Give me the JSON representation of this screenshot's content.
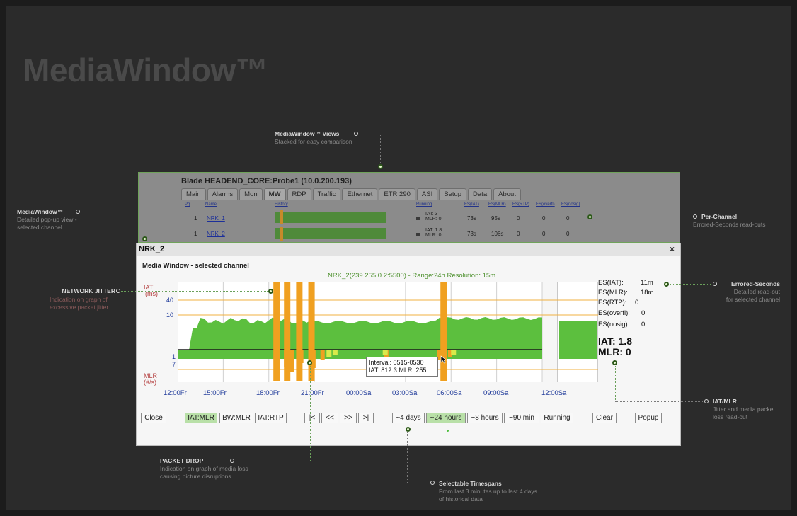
{
  "brand": "MediaWindow™",
  "annotations": {
    "views": {
      "title": "MediaWindow™ Views",
      "desc": "Stacked for easy comparison"
    },
    "popup": {
      "title": "MediaWindow™",
      "desc1": "Detailed pop-up view -",
      "desc2": "selected channel"
    },
    "per_channel": {
      "title": "Per-Channel",
      "desc": "Errored-Seconds read-outs"
    },
    "jitter": {
      "title": "NETWORK JITTER",
      "desc1": "Indication on graph of",
      "desc2": "excessive packet jitter"
    },
    "errored": {
      "title": "Errored-Seconds",
      "desc1": "Detailed read-out",
      "desc2": "for selected channel"
    },
    "iat_mlr": {
      "title": "IAT/MLR",
      "desc1": "Jitter and media packet",
      "desc2": "loss read-out"
    },
    "packet_drop": {
      "title": "PACKET DROP",
      "desc1": "Indication on graph of media loss",
      "desc2": "causing picture disruptions"
    },
    "timespans": {
      "title": "Selectable Timespans",
      "desc1": "From last 3 minutes up to last 4 days",
      "desc2": "of historical data"
    }
  },
  "blade": {
    "title": "Blade HEADEND_CORE:Probe1 (10.0.200.193)",
    "tabs": [
      "Main",
      "Alarms",
      "Mon",
      "MW",
      "RDP",
      "Traffic",
      "Ethernet",
      "ETR 290",
      "ASI",
      "Setup",
      "Data",
      "About"
    ],
    "active_tab": "MW",
    "headers": {
      "pg": "Pg",
      "name": "Name",
      "history": "History",
      "running": "Running",
      "es_iat": "ES(IAT)",
      "es_mlr": "ES(MLR)",
      "es_rtp": "ES(RTP)",
      "es_overfl": "ES(overfl)",
      "es_nosig": "ES(nosig)"
    },
    "rows": [
      {
        "pg": "1",
        "name": "NRK_1",
        "iat": "IAT: 3",
        "mlr": "MLR: 0",
        "es_iat": "73s",
        "es_mlr": "95s",
        "es_rtp": "0",
        "es_overfl": "0",
        "es_nosig": "0"
      },
      {
        "pg": "1",
        "name": "NRK_2",
        "iat": "IAT: 1.8",
        "mlr": "MLR: 0",
        "es_iat": "73s",
        "es_mlr": "106s",
        "es_rtp": "0",
        "es_overfl": "0",
        "es_nosig": "0"
      }
    ]
  },
  "popup": {
    "title": "NRK_2",
    "close_glyph": "×",
    "subtitle": "Media Window - selected channel",
    "chart_title": "NRK_2(239.255.0.2:5500) - Range:24h Resolution: 15m",
    "readouts": {
      "es_iat": "ES(IAT):",
      "es_iat_v": "11m",
      "es_mlr": "ES(MLR):",
      "es_mlr_v": "18m",
      "es_rtp": "ES(RTP):",
      "es_rtp_v": "0",
      "es_overfl": "ES(overfl):",
      "es_overfl_v": "0",
      "es_nosig": "ES(nosig):",
      "es_nosig_v": "0",
      "iat": "IAT: 1.8",
      "mlr": "MLR: 0"
    },
    "tooltip": {
      "line1": "Interval: 0515-0530",
      "line2": "IAT: 812.3  MLR: 255"
    },
    "buttons": {
      "close": "Close",
      "iat_mlr": "IAT:MLR",
      "bw_mlr": "BW:MLR",
      "iat_rtp": "IAT:RTP",
      "first": "|<",
      "prev": "<<",
      "next": ">>",
      "last": ">|",
      "d4": "~4 days",
      "h24": "~24 hours",
      "h8": "~8 hours",
      "m90": "~90 min",
      "running": "Running",
      "clear": "Clear",
      "popup": "Popup"
    }
  },
  "chart_data": {
    "type": "bar",
    "x_tick_labels": [
      "12:00Fr",
      "15:00Fr",
      "18:00Fr",
      "21:00Fr",
      "00:00Sa",
      "03:00Sa",
      "06:00Sa",
      "09:00Sa",
      "12:00Sa"
    ],
    "upper_axis": {
      "label": "IAT",
      "unit": "(ms)",
      "ticks": [
        "40",
        "10"
      ]
    },
    "lower_axis": {
      "label": "MLR",
      "unit": "(#/s)",
      "ticks": [
        "1",
        "7"
      ]
    },
    "iat_baseline_hours": [
      0,
      3,
      6,
      9,
      12,
      15,
      18,
      21,
      24
    ],
    "iat_spikes_hours": [
      6.3,
      7.0,
      7.8,
      8.6,
      17.3
    ],
    "colors": {
      "iat": "#5cbf3e",
      "spike": "#f0a020",
      "mlr": "#d8ea4a"
    }
  }
}
